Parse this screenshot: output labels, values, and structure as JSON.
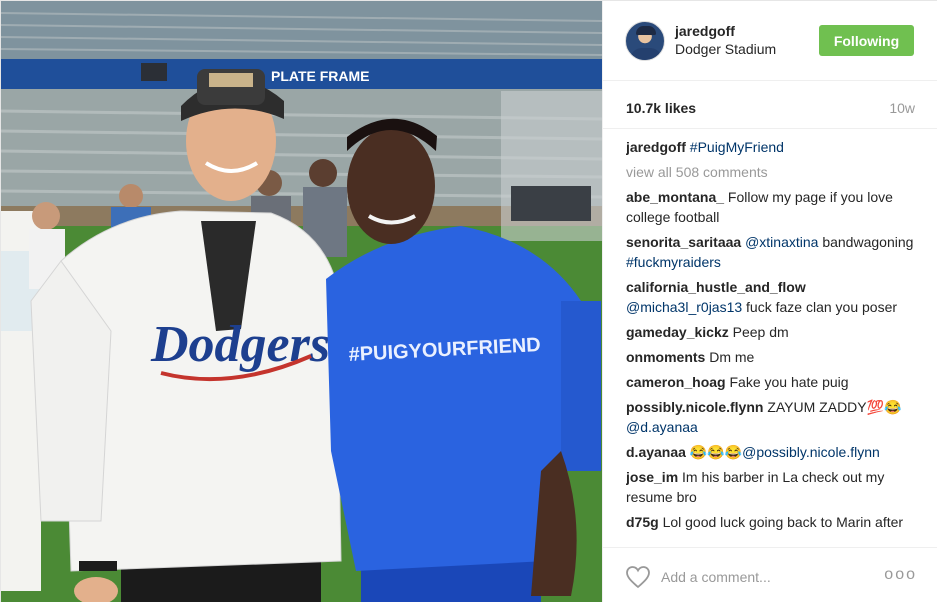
{
  "post": {
    "photo": {
      "description_icons": [
        "stadium-scene",
        "person-left-dodgers-jersey",
        "person-right-blue-shirt"
      ],
      "jersey_text": "Dodgers",
      "shirt_text": "#PUIGYOURFRIEND",
      "banner_text": "PLATE FRAME"
    },
    "header": {
      "username": "jaredgoff",
      "location": "Dodger Stadium",
      "follow_label": "Following"
    },
    "stats": {
      "likes": "10.7k likes",
      "age": "10w"
    },
    "caption": {
      "user": "jaredgoff",
      "text": "#PuigMyFriend"
    },
    "view_all": "view all 508 comments",
    "comments": [
      {
        "user": "abe_montana_",
        "text": " Follow my page if you love college football",
        "link": ""
      },
      {
        "user": "senorita_saritaaa",
        "link": " @xtinaxtina",
        "text": " bandwagoning ",
        "link2": "#fuckmyraiders"
      },
      {
        "user": "california_hustle_and_flow",
        "link": " @micha3l_r0jas13",
        "text": " fuck faze clan you poser"
      },
      {
        "user": "gameday_kickz",
        "text": " Peep dm"
      },
      {
        "user": "onmoments",
        "text": " Dm me"
      },
      {
        "user": "cameron_hoag",
        "text": " Fake you hate puig"
      },
      {
        "user": "possibly.nicole.flynn",
        "text": " ZAYUM ZADDY💯😂 ",
        "link2": "@d.ayanaa"
      },
      {
        "user": "d.ayanaa",
        "text": " 😂😂😂",
        "link2": "@possibly.nicole.flynn"
      },
      {
        "user": "jose_im",
        "text": " Im his barber in La check out my resume bro"
      },
      {
        "user": "d75g",
        "text": " Lol good luck going back to Marin after wearing that jersey"
      }
    ],
    "footer": {
      "comment_placeholder": "Add a comment...",
      "more_label": "ooo"
    }
  }
}
